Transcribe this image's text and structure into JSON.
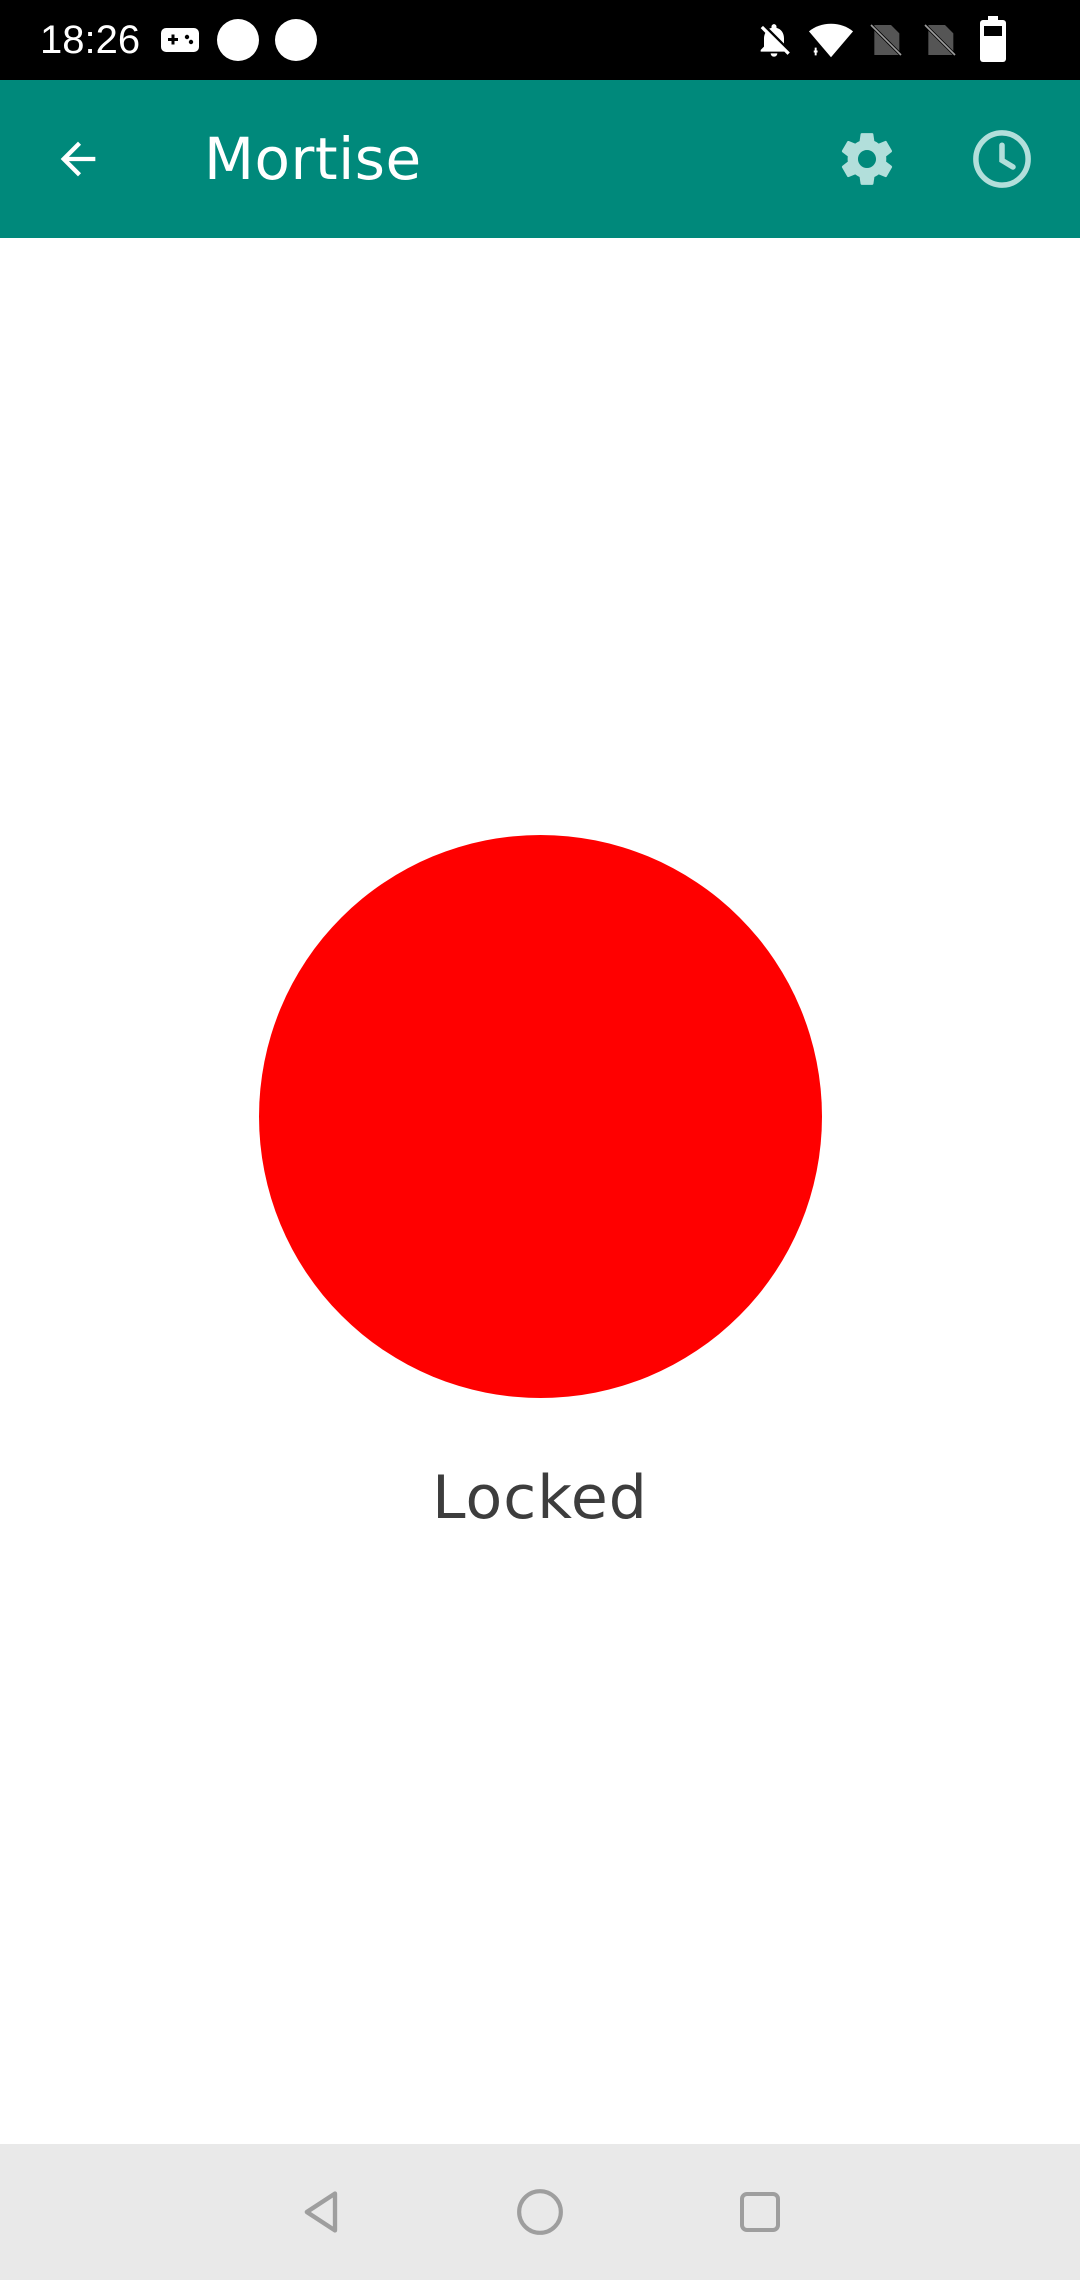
{
  "status_bar": {
    "time": "18:26",
    "icons": [
      "gamepad-icon",
      "notification-dot-icon",
      "notification-dot-icon",
      "bell-off-icon",
      "wifi-icon",
      "no-sim-icon",
      "no-sim-icon",
      "battery-icon"
    ]
  },
  "app_bar": {
    "title": "Mortise",
    "back_icon": "arrow-back-icon",
    "settings_icon": "gear-icon",
    "history_icon": "clock-icon",
    "background_color": "#00897b",
    "icon_tint": "#b2dfdb"
  },
  "lock": {
    "status_label": "Locked",
    "indicator_color": "#ff0000"
  },
  "nav_bar": {
    "icons": [
      "back-triangle-icon",
      "home-circle-icon",
      "recents-square-icon"
    ]
  }
}
